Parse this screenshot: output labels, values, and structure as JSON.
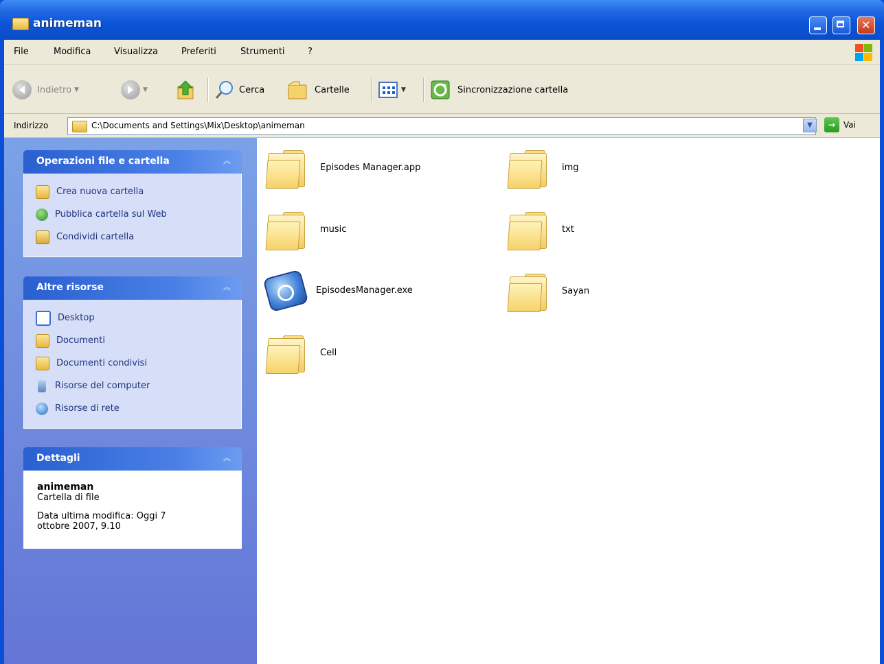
{
  "window": {
    "title": "animeman"
  },
  "menu": {
    "items": [
      "File",
      "Modifica",
      "Visualizza",
      "Preferiti",
      "Strumenti",
      "?"
    ]
  },
  "toolbar": {
    "back_label": "Indietro",
    "search_label": "Cerca",
    "folders_label": "Cartelle",
    "sync_label": "Sincronizzazione cartella"
  },
  "address": {
    "label": "Indirizzo",
    "path": "C:\\Documents and Settings\\Mix\\Desktop\\animeman",
    "go_label": "Vai"
  },
  "taskpane": {
    "file_ops": {
      "title": "Operazioni file e cartella",
      "items": [
        "Crea nuova cartella",
        "Pubblica cartella sul Web",
        "Condividi cartella"
      ]
    },
    "other": {
      "title": "Altre risorse",
      "items": [
        "Desktop",
        "Documenti",
        "Documenti condivisi",
        "Risorse del computer",
        "Risorse di rete"
      ]
    },
    "details": {
      "title": "Dettagli",
      "name": "animeman",
      "type": "Cartella di file",
      "modified": "Data ultima modifica: Oggi 7 ottobre 2007, 9.10"
    }
  },
  "files": [
    {
      "name": "Episodes Manager.app",
      "icon": "folder-icon"
    },
    {
      "name": "img",
      "icon": "folder-icon"
    },
    {
      "name": "music",
      "icon": "folder-icon"
    },
    {
      "name": "txt",
      "icon": "folder-icon"
    },
    {
      "name": "EpisodesManager.exe",
      "icon": "application-icon"
    },
    {
      "name": "Sayan",
      "icon": "folder-icon"
    },
    {
      "name": "Cell",
      "icon": "folder-icon"
    }
  ],
  "colors": {
    "titlebar": "#0a55d8",
    "taskpane": "#7ba2e7",
    "task_link": "#21347d"
  }
}
